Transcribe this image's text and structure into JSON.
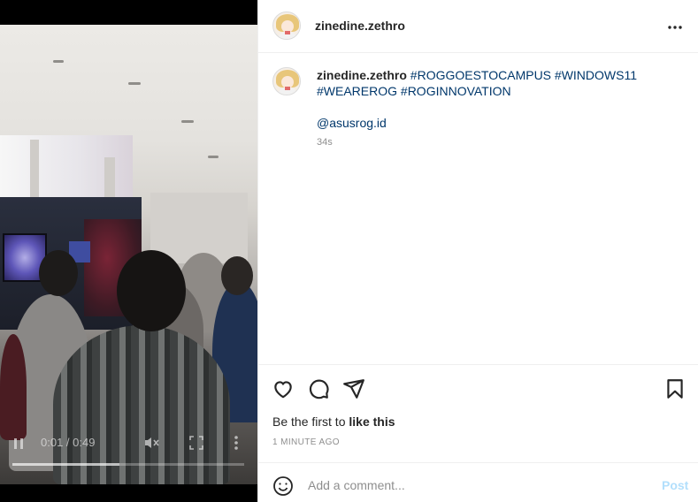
{
  "post": {
    "username": "zinedine.zethro",
    "caption_user": "zinedine.zethro",
    "hashtags": [
      "#ROGGOESTOCAMPUS",
      "#WINDOWS11",
      "#WEAREROG",
      "#ROGINNOVATION"
    ],
    "mention": "@asusrog.id",
    "caption_age": "34s",
    "likes_prefix": "Be the first to ",
    "likes_action": "like this",
    "timestamp": "1 MINUTE AGO"
  },
  "video": {
    "time_display": "0:01 / 0:49",
    "progress_fraction": 0.46
  },
  "comment": {
    "placeholder": "Add a comment...",
    "post_label": "Post"
  },
  "icons": {
    "options": "more-horizontal-icon",
    "like": "heart-icon",
    "comment": "comment-icon",
    "share": "send-icon",
    "save": "bookmark-icon",
    "emoji": "emoji-icon"
  },
  "colors": {
    "hashtag": "#00376b",
    "text": "#262626",
    "muted": "#8e8e8e",
    "post_button_disabled": "#b2dffc"
  }
}
